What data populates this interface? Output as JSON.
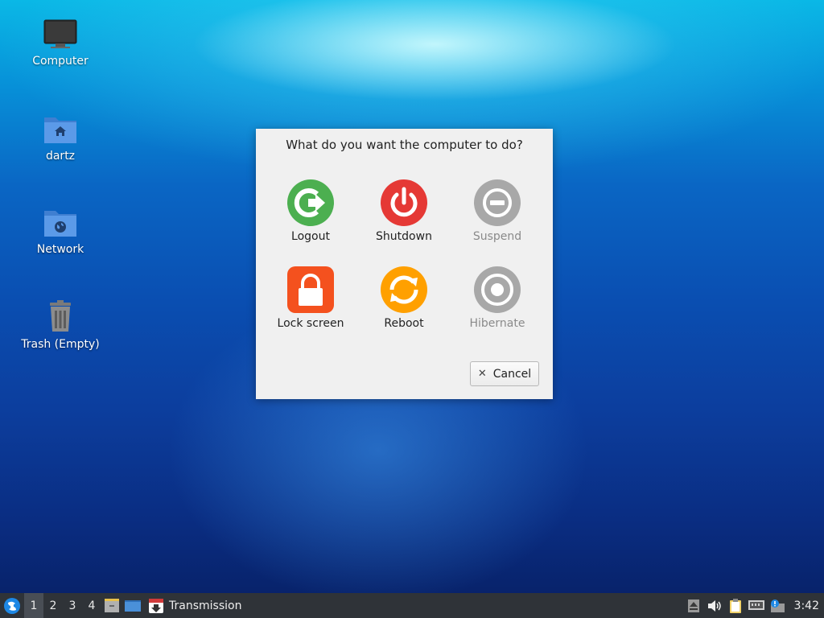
{
  "desktop": {
    "icons": [
      {
        "label": "Computer",
        "icon": "computer-icon"
      },
      {
        "label": "dartz",
        "icon": "home-folder-icon"
      },
      {
        "label": "Network",
        "icon": "network-folder-icon"
      },
      {
        "label": "Trash (Empty)",
        "icon": "trash-icon"
      }
    ]
  },
  "dialog": {
    "title": "What do you want the computer to do?",
    "actions": [
      {
        "label": "Logout",
        "icon": "logout-icon",
        "color": "#4caf50",
        "enabled": true
      },
      {
        "label": "Shutdown",
        "icon": "power-icon",
        "color": "#e53935",
        "enabled": true
      },
      {
        "label": "Suspend",
        "icon": "suspend-icon",
        "color": "#a8a8a8",
        "enabled": false
      },
      {
        "label": "Lock screen",
        "icon": "lock-icon",
        "color": "#f4511e",
        "enabled": true
      },
      {
        "label": "Reboot",
        "icon": "reboot-icon",
        "color": "#ffa000",
        "enabled": true
      },
      {
        "label": "Hibernate",
        "icon": "hibernate-icon",
        "color": "#a8a8a8",
        "enabled": false
      }
    ],
    "cancel_label": "Cancel"
  },
  "taskbar": {
    "workspaces": [
      "1",
      "2",
      "3",
      "4"
    ],
    "active_workspace": "1",
    "task_label": "Transmission",
    "clock": "3:42"
  }
}
